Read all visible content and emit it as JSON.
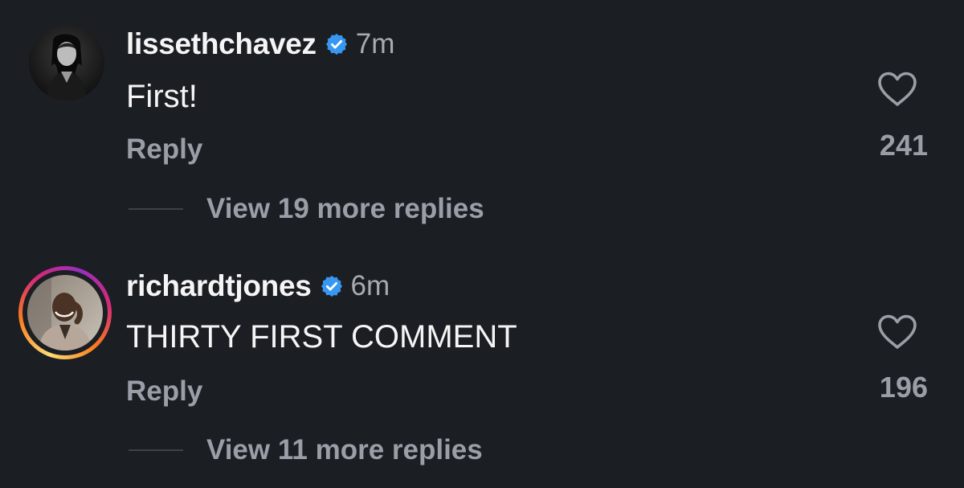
{
  "comments": [
    {
      "username": "lissethchavez",
      "verified": true,
      "verified_icon": "verified-badge-icon",
      "time": "7m",
      "text": "First!",
      "reply_label": "Reply",
      "likes": "241",
      "like_icon": "heart-outline-icon",
      "view_replies": "View 19 more replies",
      "has_story_ring": false
    },
    {
      "username": "richardtjones",
      "verified": true,
      "verified_icon": "verified-badge-icon",
      "time": "6m",
      "text": "THIRTY FIRST COMMENT",
      "reply_label": "Reply",
      "likes": "196",
      "like_icon": "heart-outline-icon",
      "view_replies": "View 11 more replies",
      "has_story_ring": true
    }
  ],
  "colors": {
    "background": "#1b1e23",
    "primary_text": "#f5f5f5",
    "secondary_text": "#9a9ea7",
    "verified_blue": "#3897f0"
  }
}
